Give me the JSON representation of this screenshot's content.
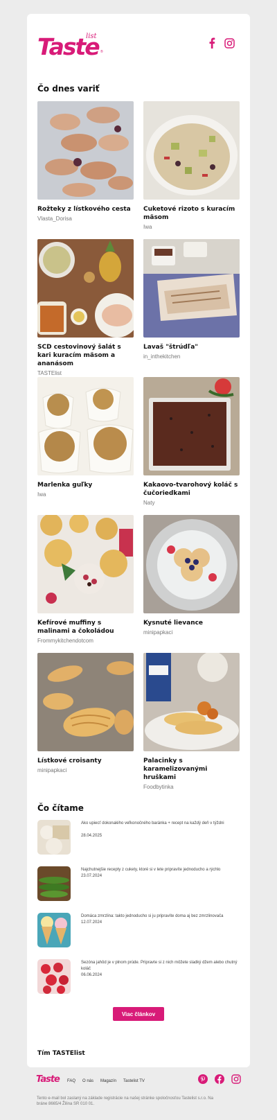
{
  "brand": {
    "logo_text": "Taste",
    "logo_sub": "list",
    "accent": "#d81b78"
  },
  "header": {
    "social": [
      "facebook-icon",
      "instagram-icon"
    ]
  },
  "recipes_section": {
    "title": "Čo dnes variť",
    "items": [
      {
        "name": "Rožteky z lístkového cesta",
        "author": "Vlasta_Dorisa"
      },
      {
        "name": "Cuketové rizoto s kuracím mäsom",
        "author": "Iwa"
      },
      {
        "name": "SCD cestovinový šalát s kari kuracím mäsom a ananásom",
        "author": "TASTElist"
      },
      {
        "name": "Lavaš \"štrúdľa\"",
        "author": "in_inthekitchen"
      },
      {
        "name": "Marlenka guľky",
        "author": "Iwa"
      },
      {
        "name": "Kakaovo-tvarohový koláč s čučoriedkami",
        "author": "Naty"
      },
      {
        "name": "Kefírové muffiny s malinami a čokoládou",
        "author": "Frommykitchendotcom"
      },
      {
        "name": "Kysnuté lievance",
        "author": "minipapkaci"
      },
      {
        "name": "Lístkové croisanty",
        "author": "minipapkaci"
      },
      {
        "name": "Palacinky s karamelizovanými hruškami",
        "author": "Foodbytinka"
      }
    ]
  },
  "articles_section": {
    "title": "Čo čítame",
    "items": [
      {
        "title": "Ako upiecť dokonalého veľkonočného baránka + recept na každý deň v týždni",
        "date": "28.04.2025"
      },
      {
        "title": "Najchutnejšie recepty z cukety, ktoré si v lete pripravíte jednoducho a rýchlo",
        "date": "23.07.2024"
      },
      {
        "title": "Domáca zmrzlina: takto jednoducho si ju pripravíte doma aj bez zmrzlinovača",
        "date": "12.07.2024"
      },
      {
        "title": "Sezóna jahôd je v plnom prúde. Pripravte si z nich môžete sladký džem alebo chutný koláč",
        "date": "06.06.2024"
      }
    ],
    "more_label": "Viac článkov"
  },
  "signature": "Tím TASTElist",
  "footer": {
    "logo_text": "Taste",
    "nav": [
      "FAQ",
      "O nás",
      "Magazín",
      "Tastelist TV"
    ],
    "social": [
      "pinterest-icon",
      "facebook-icon",
      "instagram-icon"
    ],
    "note": "Tento e-mail bol zaslaný na základe registrácie na našej stránke spoločnosťou Tastelist s.r.o. Na bráne 8665/4 Žilina SR 010 01."
  }
}
